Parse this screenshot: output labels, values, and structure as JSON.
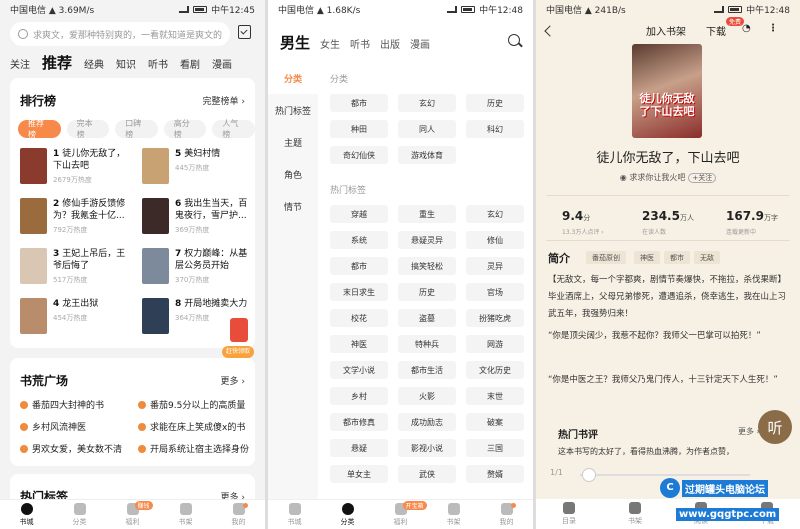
{
  "screen1": {
    "status": {
      "left": "中国电信 ▲ 3.69M/s",
      "right": "中午12:45"
    },
    "search_placeholder": "求爽文，爱那种特别爽的，一看就知道是爽文的",
    "channel_tabs": [
      "关注",
      "推荐",
      "经典",
      "知识",
      "听书",
      "看剧",
      "漫画"
    ],
    "ranking": {
      "title": "排行榜",
      "more": "完整榜单 ›",
      "pills": [
        "推荐榜",
        "完本榜",
        "口碑榜",
        "高分榜",
        "人气榜"
      ],
      "items": [
        {
          "num": "1",
          "title": "徒儿你无敌了，下山去吧",
          "hot": "2679万热度",
          "color": "#8b3a2e"
        },
        {
          "num": "5",
          "title": "美妇村情",
          "hot": "445万热度",
          "color": "#c9a274"
        },
        {
          "num": "2",
          "title": "修仙手游反馈修为？我氪金十亿...",
          "hot": "792万热度",
          "color": "#9a6b3d"
        },
        {
          "num": "6",
          "title": "我出生当天，百鬼夜行，雪尸护...",
          "hot": "369万热度",
          "color": "#3b2a28"
        },
        {
          "num": "3",
          "title": "王妃上吊后，王爷后悔了",
          "hot": "517万热度",
          "color": "#d9c6b3"
        },
        {
          "num": "7",
          "title": "权力巅峰：从基层公务员开始",
          "hot": "370万热度",
          "color": "#7d8a9c"
        },
        {
          "num": "4",
          "title": "龙王出狱",
          "hot": "454万热度",
          "color": "#b98c6b"
        },
        {
          "num": "8",
          "title": "开局地摊卖大力",
          "hot": "364万热度",
          "color": "#2f3f55"
        }
      ]
    },
    "gift_label": "赶快领取",
    "bookland": {
      "title": "书荒广场",
      "more": "更多 ›",
      "items": [
        "番茄四大封神的书",
        "番茄9.5分以上的高质量",
        "乡村风流神医",
        "求能在床上笑成傻x的书",
        "男欢女爱，美女数不清",
        "开局系统让宿主选择身份"
      ]
    },
    "hot_tags": {
      "title": "热门标签",
      "more": "更多 ›"
    },
    "tabbar": [
      "书城",
      "分类",
      "福利",
      "书架",
      "我的"
    ],
    "badge": "赚钱"
  },
  "screen2": {
    "status": {
      "left": "中国电信 ▲ 1.68K/s",
      "right": "中午12:48"
    },
    "gender_tabs": [
      "男生",
      "女生",
      "听书",
      "出版",
      "漫画"
    ],
    "side": [
      "分类",
      "热门标签",
      "主题",
      "角色",
      "情节"
    ],
    "sec1": "分类",
    "cats": [
      "都市",
      "玄幻",
      "历史",
      "种田",
      "同人",
      "科幻",
      "奇幻仙侠",
      "游戏体育"
    ],
    "sec2": "热门标签",
    "tags": [
      "穿越",
      "重生",
      "玄幻",
      "系统",
      "悬疑灵异",
      "修仙",
      "都市",
      "搞笑轻松",
      "灵异",
      "末日求生",
      "历史",
      "官场",
      "校花",
      "盗墓",
      "扮猪吃虎",
      "神医",
      "特种兵",
      "网游",
      "文学小说",
      "都市生活",
      "文化历史",
      "乡村",
      "火影",
      "末世",
      "都市修真",
      "成功励志",
      "破案",
      "悬疑",
      "影视小说",
      "三国",
      "单女主",
      "武侠",
      "赘婿"
    ],
    "tabbar": [
      "书城",
      "分类",
      "福利",
      "书架",
      "我的"
    ],
    "badge": "开宝箱"
  },
  "screen3": {
    "status": {
      "left": "中国电信 ▲ 241B/s",
      "right": "中午12:48"
    },
    "top": [
      "加入书架",
      "下载"
    ],
    "dl_badge": "免费",
    "cover_text": "徒儿你无敌了下山去吧",
    "title": "徒儿你无敌了，下山去吧",
    "author": "求求你让我火吧",
    "follow": "+关注",
    "stats": [
      {
        "v": "9.4",
        "u": "分",
        "sub": "13.3万人点评 ›"
      },
      {
        "v": "234.5",
        "u": "万人",
        "sub": "在读人数"
      },
      {
        "v": "167.9",
        "u": "万字",
        "sub": "连载更新中"
      }
    ],
    "intro_title": "简介",
    "intro_tags": [
      "番茄原创",
      "神医",
      "都市",
      "无敌"
    ],
    "intro": [
      "【无敌文，每一个字都爽，剧情节奏爆快，不拖拉，杀伐果断】毕业酒席上，父母兄弟惨死，遭遇追杀，侥幸逃生，我在山上习武五年，我强势归来！",
      "“你是顶尖阔少，我惹不起你？我师父一巴掌可以拍死！”",
      "“你是中医之王？我师父乃鬼门传人，十三针定天下人生死！”"
    ],
    "listen": "听",
    "comments_title": "热门书评",
    "comments_more": "更多 ›",
    "comment": "这本书写的太好了，看得热血沸腾，为作者点赞，",
    "progress": "1/1",
    "tabbar": [
      "目录",
      "书架",
      "阅读",
      "下载"
    ]
  },
  "watermark": {
    "l1": "过期罐头电脑论坛",
    "l2": "www.gqgtpc.com"
  }
}
